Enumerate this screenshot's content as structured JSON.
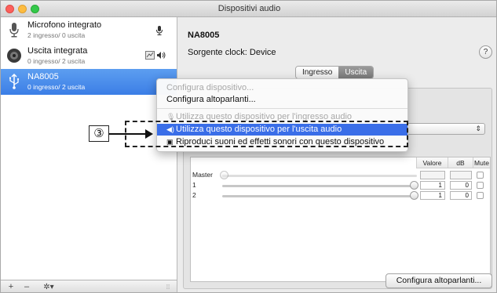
{
  "window": {
    "title": "Dispositivi audio"
  },
  "sidebar": {
    "devices": [
      {
        "name": "Microfono integrato",
        "sub": "2 ingresso/ 0 uscita"
      },
      {
        "name": "Uscita integrata",
        "sub": "0 ingresso/ 2 uscita"
      },
      {
        "name": "NA8005",
        "sub": "0 ingresso/ 2 uscita"
      }
    ],
    "footer": {
      "add": "+",
      "remove": "–",
      "gear": "✲▾"
    }
  },
  "main": {
    "device_title": "NA8005",
    "clock_label": "Sorgente clock:",
    "clock_value": "Device",
    "help": "?",
    "tabs": [
      {
        "label": "Ingresso"
      },
      {
        "label": "Uscita"
      }
    ],
    "select_arrow": "⇕",
    "volume_columns": [
      "Valore",
      "dB",
      "Mute"
    ],
    "channels": [
      {
        "label": "Master",
        "value": "",
        "db": ""
      },
      {
        "label": "1",
        "value": "1",
        "db": "0"
      },
      {
        "label": "2",
        "value": "1",
        "db": "0"
      }
    ],
    "configure_button": "Configura altoparlanti..."
  },
  "context_menu": {
    "items": [
      {
        "label": "Configura dispositivo...",
        "enabled": false
      },
      {
        "label": "Configura altoparlanti...",
        "enabled": true
      },
      {
        "label": "Utilizza questo dispositivo per l'ingresso audio",
        "enabled": false,
        "icon": "mic-icon"
      },
      {
        "label": "Utilizza questo dispositivo per l'uscita audio",
        "enabled": true,
        "highlighted": true,
        "icon": "speaker-icon"
      },
      {
        "label": "Riproduci suoni ed effetti sonori con questo dispositivo",
        "enabled": true,
        "icon": "finder-icon"
      }
    ]
  },
  "annotation": {
    "number": "③"
  },
  "colors": {
    "selection": "#3b7ee6",
    "highlight": "#3a6ee8",
    "tab_active": "#8a8a8a"
  }
}
